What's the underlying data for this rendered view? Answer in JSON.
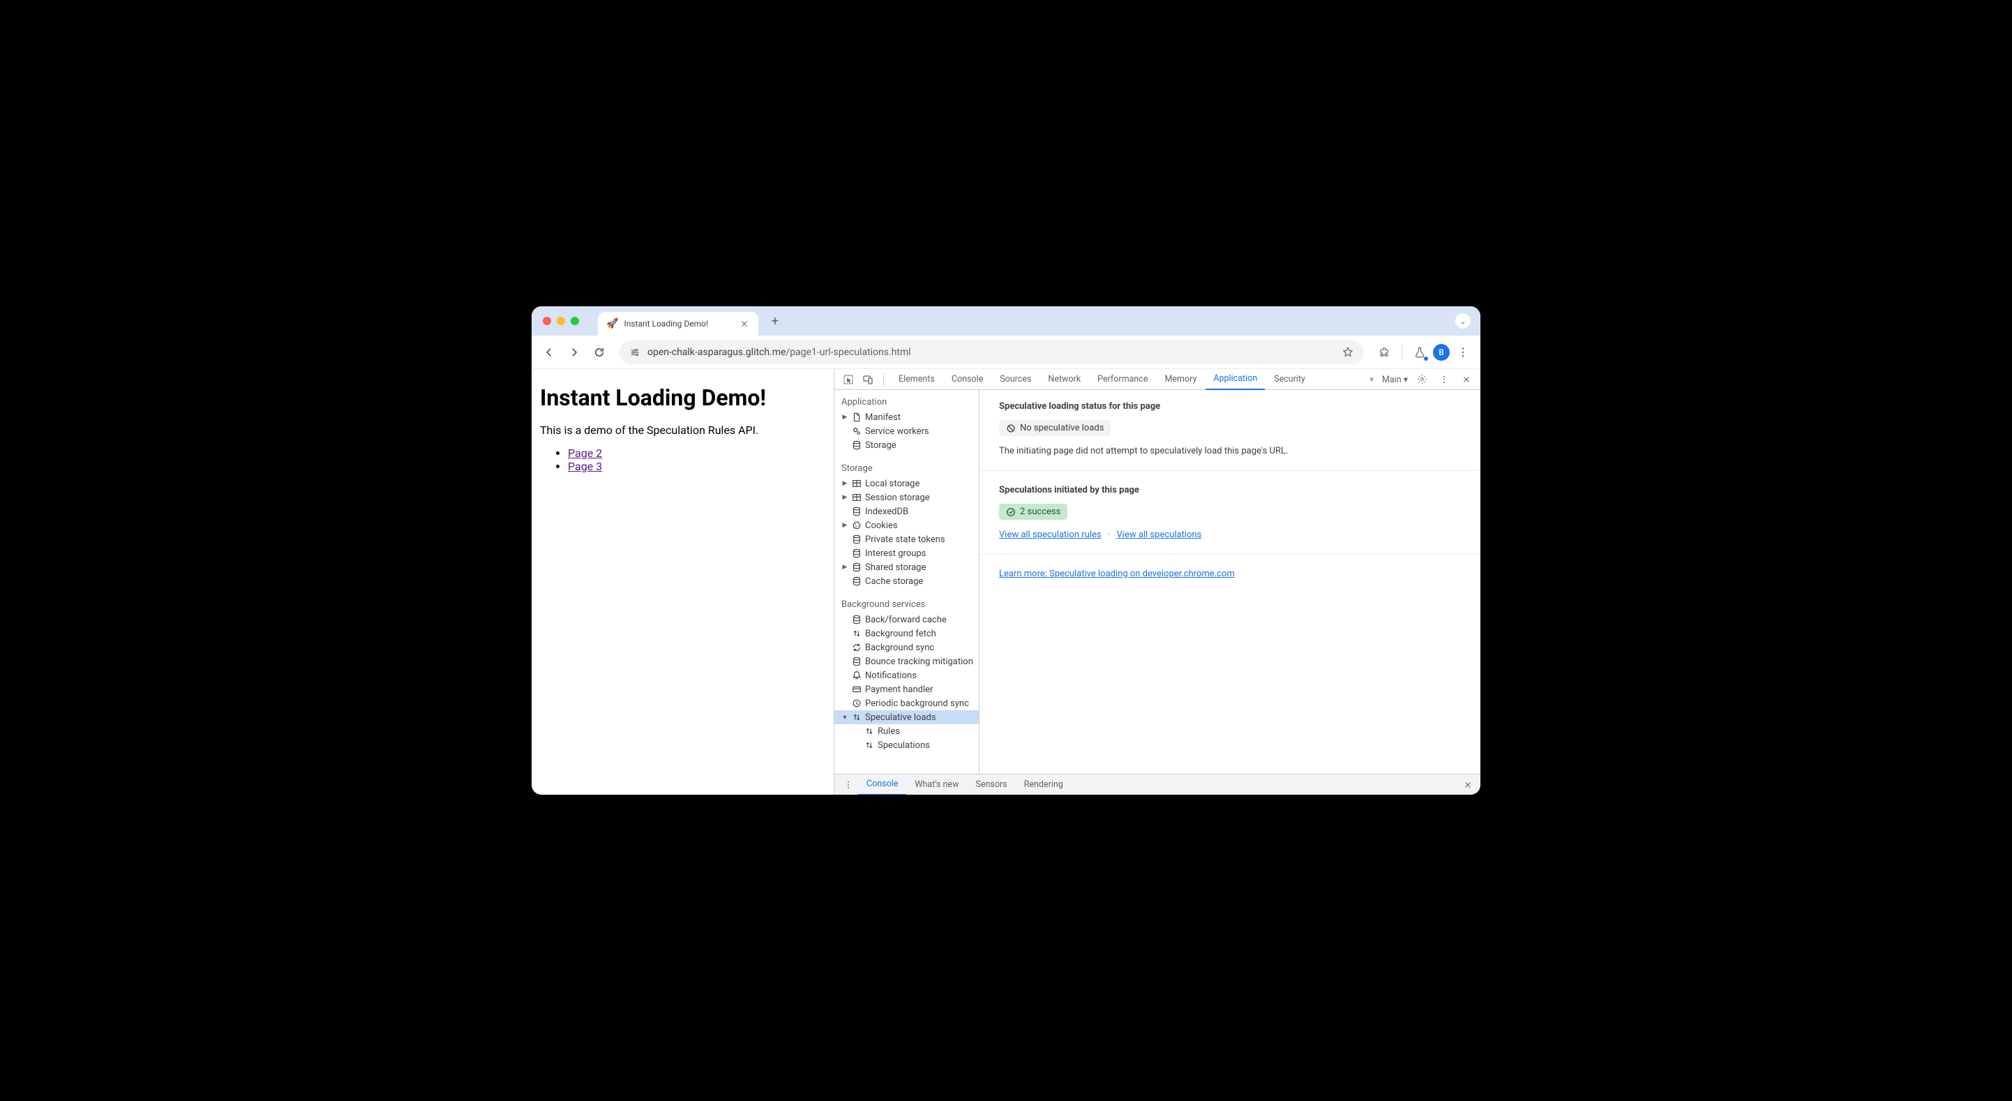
{
  "browser": {
    "tab_title": "Instant Loading Demo!",
    "tab_emoji": "🚀",
    "url_host": "open-chalk-asparagus.glitch.me",
    "url_path": "/page1-url-speculations.html",
    "avatar_letter": "B"
  },
  "page": {
    "heading": "Instant Loading Demo!",
    "description": "This is a demo of the Speculation Rules API.",
    "links": [
      "Page 2",
      "Page 3"
    ]
  },
  "devtools": {
    "tabs": [
      "Elements",
      "Console",
      "Sources",
      "Network",
      "Performance",
      "Memory",
      "Application",
      "Security"
    ],
    "active_tab": "Application",
    "target_label": "Main",
    "sidebar": {
      "application": {
        "title": "Application",
        "items": [
          {
            "label": "Manifest",
            "icon": "file",
            "expandable": true
          },
          {
            "label": "Service workers",
            "icon": "gears"
          },
          {
            "label": "Storage",
            "icon": "db"
          }
        ]
      },
      "storage": {
        "title": "Storage",
        "items": [
          {
            "label": "Local storage",
            "icon": "table",
            "expandable": true
          },
          {
            "label": "Session storage",
            "icon": "table",
            "expandable": true
          },
          {
            "label": "IndexedDB",
            "icon": "db"
          },
          {
            "label": "Cookies",
            "icon": "cookie",
            "expandable": true
          },
          {
            "label": "Private state tokens",
            "icon": "db"
          },
          {
            "label": "Interest groups",
            "icon": "db"
          },
          {
            "label": "Shared storage",
            "icon": "db",
            "expandable": true
          },
          {
            "label": "Cache storage",
            "icon": "db"
          }
        ]
      },
      "background": {
        "title": "Background services",
        "items": [
          {
            "label": "Back/forward cache",
            "icon": "db"
          },
          {
            "label": "Background fetch",
            "icon": "updown"
          },
          {
            "label": "Background sync",
            "icon": "sync"
          },
          {
            "label": "Bounce tracking mitigation",
            "icon": "db"
          },
          {
            "label": "Notifications",
            "icon": "bell"
          },
          {
            "label": "Payment handler",
            "icon": "card"
          },
          {
            "label": "Periodic background sync",
            "icon": "clock"
          },
          {
            "label": "Speculative loads",
            "icon": "updown",
            "expandable": true,
            "expanded": true,
            "selected": true
          },
          {
            "label": "Rules",
            "icon": "updown",
            "child": true
          },
          {
            "label": "Speculations",
            "icon": "updown",
            "child": true
          }
        ]
      }
    },
    "main": {
      "status_heading": "Speculative loading status for this page",
      "status_badge": "No speculative loads",
      "status_text": "The initiating page did not attempt to speculatively load this page's URL.",
      "initiated_heading": "Speculations initiated by this page",
      "success_badge": "2 success",
      "link_rules": "View all speculation rules",
      "link_specs": "View all speculations",
      "learn_more": "Learn more: Speculative loading on developer.chrome.com"
    },
    "drawer": {
      "tabs": [
        "Console",
        "What's new",
        "Sensors",
        "Rendering"
      ],
      "active": "Console"
    }
  }
}
